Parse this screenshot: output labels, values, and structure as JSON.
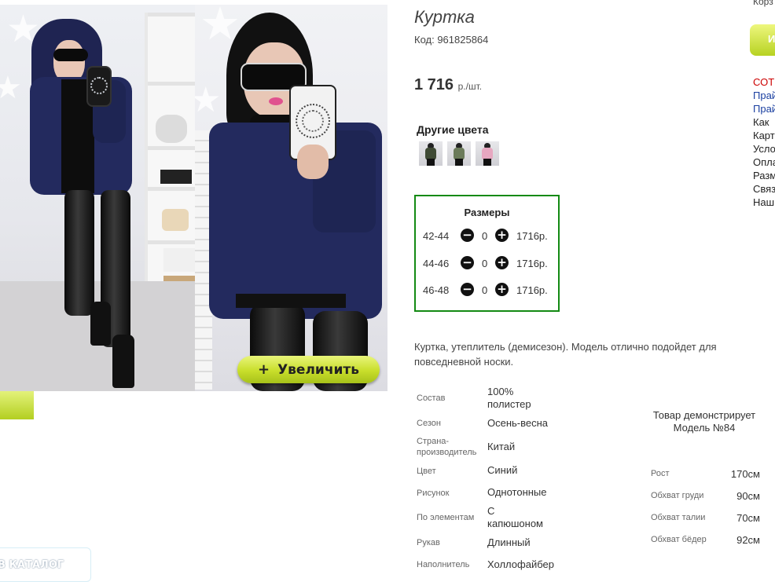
{
  "gallery": {
    "zoom_button_label": "Увеличить",
    "zoom_icon": "plus-icon",
    "catalog_button_label": "В КАТАЛОГ"
  },
  "product": {
    "title": "Куртка",
    "code": "Код: 961825864",
    "price": "1 716",
    "price_unit": "р./шт.",
    "other_colors_title": "Другие цвета",
    "other_colors": [
      {
        "name": "swatch-1",
        "color": "#3f4a34"
      },
      {
        "name": "swatch-2",
        "color": "#6b7b5a"
      },
      {
        "name": "swatch-3",
        "color": "#e7a7c0"
      }
    ],
    "description": "Куртка, утеплитель (демисезон). Модель отлично подойдет для повседневной носки."
  },
  "sizes": {
    "title": "Размеры",
    "rows": [
      {
        "label": "42-44",
        "qty": "0",
        "price": "1716р."
      },
      {
        "label": "44-46",
        "qty": "0",
        "price": "1716р."
      },
      {
        "label": "46-48",
        "qty": "0",
        "price": "1716р."
      }
    ]
  },
  "specs": [
    {
      "label": "Состав",
      "value": "100% полистер"
    },
    {
      "label": "Сезон",
      "value": "Осень-весна"
    },
    {
      "label": "Страна-производитель",
      "value": "Китай"
    },
    {
      "label": "Цвет",
      "value": "Синий"
    },
    {
      "label": "Рисунок",
      "value": "Однотонные"
    },
    {
      "label": "По элементам",
      "value": "С капюшоном"
    },
    {
      "label": "Рукав",
      "value": "Длинный"
    },
    {
      "label": "Наполнитель",
      "value": "Холлофайбер"
    }
  ],
  "model": {
    "note": "Товар демонстрирует Модель №84",
    "measurements": [
      {
        "label": "Рост",
        "value": "170см"
      },
      {
        "label": "Обхват груди",
        "value": "90см"
      },
      {
        "label": "Обхват талии",
        "value": "70см"
      },
      {
        "label": "Обхват бёдер",
        "value": "92см"
      }
    ]
  },
  "right_column": {
    "top_text": "Корз",
    "button_text": "И",
    "links": [
      {
        "text": "СОТ",
        "color": "#cc0000"
      },
      {
        "text": "Прай",
        "color": "#1a3fa0"
      },
      {
        "text": "Прай",
        "color": "#1a3fa0"
      },
      {
        "text": "Как",
        "color": "#222222"
      },
      {
        "text": "Карт",
        "color": "#222222"
      },
      {
        "text": "Усло",
        "color": "#222222"
      },
      {
        "text": "Опла",
        "color": "#222222"
      },
      {
        "text": "Разм",
        "color": "#222222"
      },
      {
        "text": "Связ",
        "color": "#222222"
      },
      {
        "text": "Наш",
        "color": "#222222"
      }
    ]
  }
}
